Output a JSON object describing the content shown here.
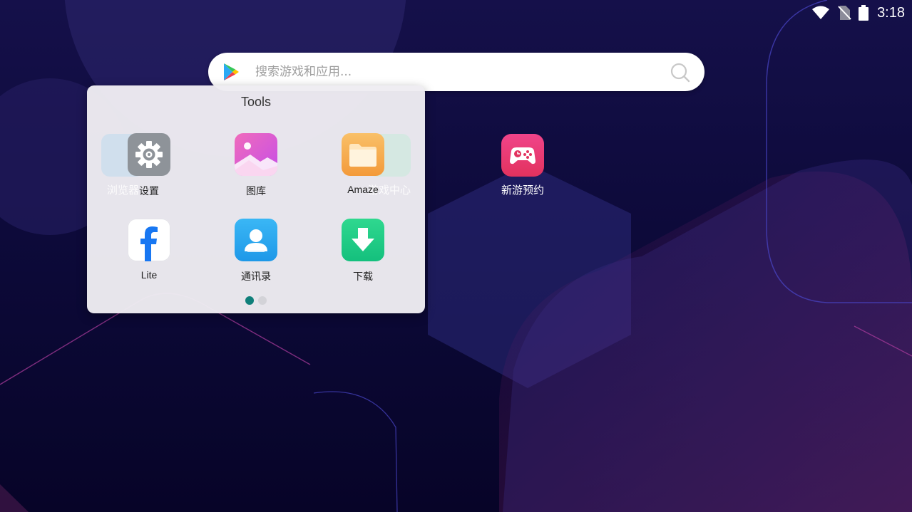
{
  "status_bar": {
    "time": "3:18",
    "icons": [
      "wifi-icon",
      "no-sim-icon",
      "battery-icon"
    ]
  },
  "search": {
    "placeholder": "搜索游戏和应用..."
  },
  "desktop": {
    "apps": [
      {
        "label": "浏览器",
        "icon": "browser-icon"
      },
      {
        "label": "游戏中心",
        "icon": "game-center-icon"
      },
      {
        "label": "新游预约",
        "icon": "gamepad-icon"
      }
    ]
  },
  "folder": {
    "title": "Tools",
    "apps": [
      {
        "label": "设置",
        "icon": "settings-gear-icon",
        "color": "#8e9399"
      },
      {
        "label": "图库",
        "icon": "gallery-icon",
        "color": "#e75bd8"
      },
      {
        "label": "Amaze",
        "icon": "folder-icon",
        "color": "#f6ae4a"
      },
      {
        "label": "Lite",
        "icon": "facebook-icon",
        "color": "#1877f2"
      },
      {
        "label": "通讯录",
        "icon": "contacts-icon",
        "color": "#2aa8f0"
      },
      {
        "label": "下载",
        "icon": "download-icon",
        "color": "#1fce8a"
      }
    ],
    "page_count": 2,
    "current_page": 1
  },
  "colors": {
    "background": "#0d0a3a",
    "accent_dot": "#0f7f7a"
  }
}
